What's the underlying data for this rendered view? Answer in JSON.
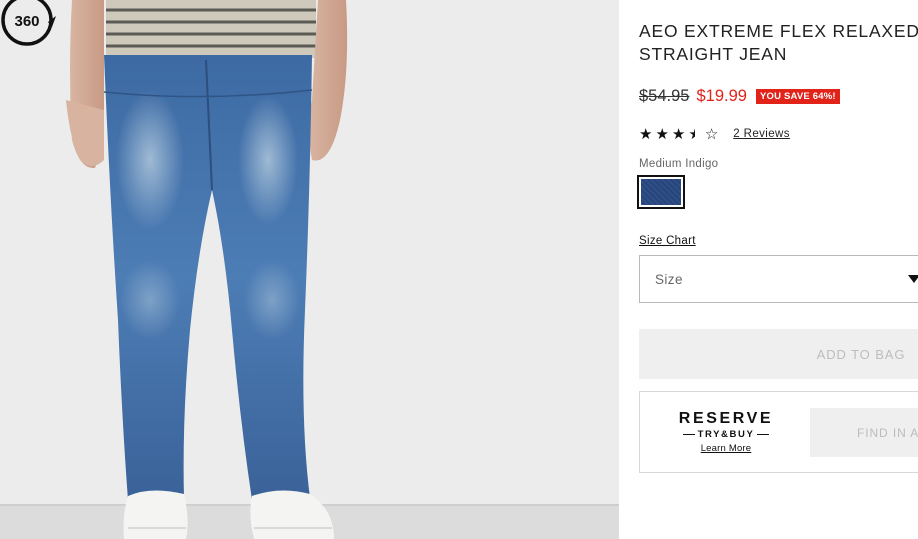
{
  "product": {
    "title_line1": "AEO EXTREME FLEX RELAXED",
    "title_line2": "STRAIGHT JEAN",
    "original_price": "$54.95",
    "sale_price": "$19.99",
    "save_badge": "YOU SAVE 64%!",
    "rating": 3.5,
    "rating_max": 5,
    "reviews_link": "2 Reviews",
    "color_label": "Medium Indigo",
    "size_chart_link": "Size Chart",
    "size_placeholder": "Size",
    "add_to_bag_label": "ADD TO BAG"
  },
  "reserve": {
    "title": "RESERVE",
    "subtitle": "TRY&BUY",
    "learn_more": "Learn More",
    "find_button": "FIND IN A STORE"
  },
  "image": {
    "spin_badge": "360",
    "swatch_color": "#2f4f87",
    "accent_sale_color": "#e2231a"
  }
}
